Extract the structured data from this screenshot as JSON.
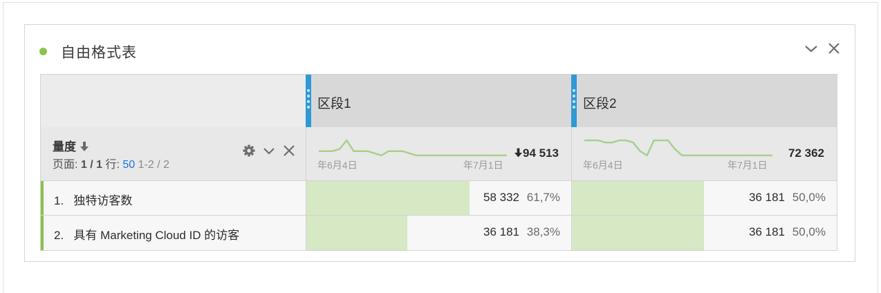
{
  "panel": {
    "title": "自由格式表",
    "status_color": "#8bc34a",
    "icons": [
      "chevron-down-icon",
      "close-icon"
    ]
  },
  "segments": [
    {
      "label": "区段1"
    },
    {
      "label": "区段2"
    }
  ],
  "metric_header": {
    "title": "量度",
    "sort_icon": "arrow-down-icon",
    "page_label": "页面:",
    "page_value": "1 / 1",
    "rows_label": "行:",
    "rows_value": "50",
    "range": "1-2 / 2",
    "icons": [
      "gear-icon",
      "chevron-down-icon",
      "close-icon"
    ]
  },
  "sparklines": [
    {
      "total": "94 513",
      "total_icon": "arrow-down-icon",
      "x_start": "年6月4日",
      "x_end": "年7月1日",
      "values": [
        3,
        3,
        3,
        4,
        8,
        3,
        3,
        3,
        2,
        1,
        3,
        3,
        3,
        2,
        1,
        1,
        1,
        1,
        1,
        1,
        1,
        1,
        1,
        1,
        1,
        1,
        1,
        1
      ]
    },
    {
      "total": "72 362",
      "x_start": "年6月4日",
      "x_end": "年7月1日",
      "values": [
        8,
        8,
        8,
        7,
        7,
        8,
        8,
        7,
        3,
        1,
        8,
        8,
        8,
        4,
        1,
        1,
        1,
        1,
        1,
        1,
        1,
        1,
        1,
        1,
        1,
        1,
        1,
        1
      ]
    }
  ],
  "rows": [
    {
      "index": "1.",
      "label": "独特访客数",
      "cells": [
        {
          "value": "58 332",
          "pct": "61,7%",
          "fill": 0.617
        },
        {
          "value": "36 181",
          "pct": "50,0%",
          "fill": 0.5
        }
      ]
    },
    {
      "index": "2.",
      "label": "具有 Marketing Cloud ID 的访客",
      "cells": [
        {
          "value": "36 181",
          "pct": "38,3%",
          "fill": 0.383
        },
        {
          "value": "36 181",
          "pct": "50,0%",
          "fill": 0.5
        }
      ]
    }
  ],
  "colors": {
    "accent": "#8bc34a",
    "segment_handle": "#2d9ad6",
    "bar_fill": "#d6e8c4",
    "sparkline": "#a8d08d"
  }
}
